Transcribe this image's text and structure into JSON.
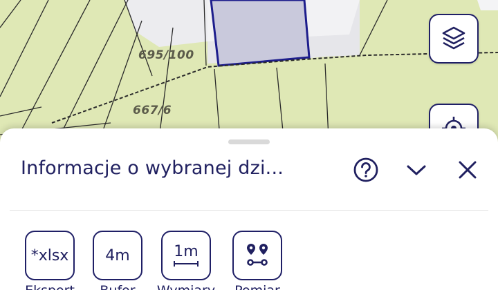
{
  "map": {
    "parcel_labels": [
      "695/100",
      "667/6"
    ],
    "colors": {
      "land": "#dfe8b5",
      "building": "#ededf0",
      "selected_parcel_border": "#1d1d8c",
      "boundary": "#2a2a2a"
    }
  },
  "map_controls": {
    "layers_icon": "layers-icon",
    "locate_icon": "locate-icon"
  },
  "sheet": {
    "title": "Informacje o wybranej dzi...",
    "help_icon": "help-circle-icon",
    "collapse_icon": "chevron-down-icon",
    "close_icon": "close-icon",
    "tools": [
      {
        "value": "*xlsx",
        "label": "Eksport"
      },
      {
        "value": "4m",
        "label": "Bufor"
      },
      {
        "value": "1m",
        "label": "Wymiary"
      },
      {
        "value": "",
        "label": "Pomiar",
        "icon": "route-points-icon"
      }
    ]
  },
  "accent_color": "#202060"
}
